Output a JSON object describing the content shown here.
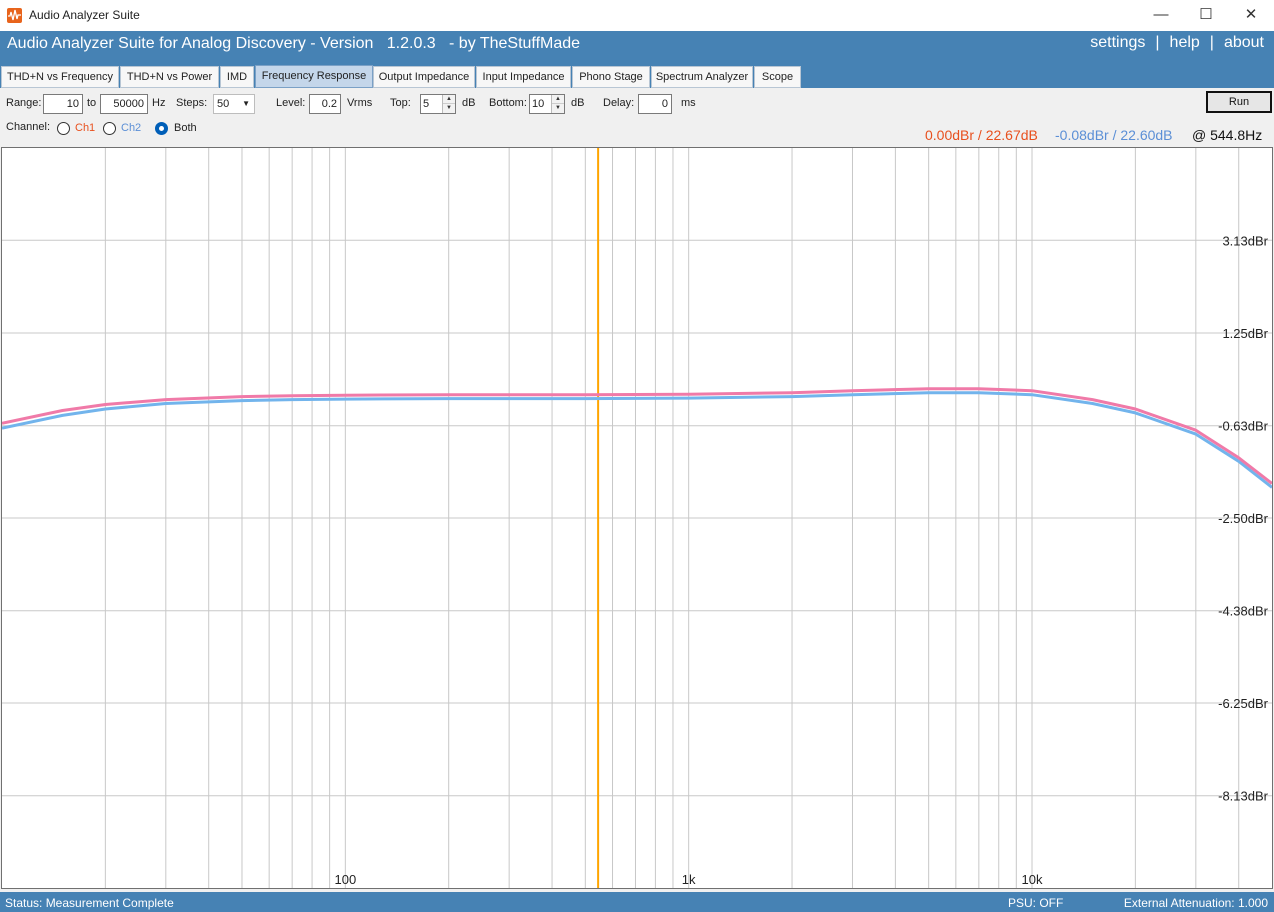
{
  "window": {
    "title": "Audio Analyzer Suite",
    "controls": {
      "minimize": "—",
      "maximize": "☐",
      "close": "✕"
    }
  },
  "header": {
    "app_title": "Audio Analyzer Suite for Analog Discovery - Version   1.2.0.3   - by TheStuffMade",
    "links": [
      "settings",
      "help",
      "about"
    ],
    "separator": "|"
  },
  "tabs": [
    {
      "label": "THD+N vs Frequency",
      "active": false
    },
    {
      "label": "THD+N vs Power",
      "active": false
    },
    {
      "label": "IMD",
      "active": false
    },
    {
      "label": "Frequency Response",
      "active": true
    },
    {
      "label": "Output Impedance",
      "active": false
    },
    {
      "label": "Input Impedance",
      "active": false
    },
    {
      "label": "Phono Stage",
      "active": false
    },
    {
      "label": "Spectrum Analyzer",
      "active": false
    },
    {
      "label": "Scope",
      "active": false
    }
  ],
  "controls": {
    "range_label": "Range:",
    "range_from": "10",
    "to_label": "to",
    "range_to": "50000",
    "hz_unit": "Hz",
    "steps_label": "Steps:",
    "steps_value": "50",
    "level_label": "Level:",
    "level_value": "0.2",
    "level_unit": "Vrms",
    "top_label": "Top:",
    "top_value": "5",
    "top_unit": "dB",
    "bottom_label": "Bottom:",
    "bottom_value": "10",
    "bottom_unit": "dB",
    "delay_label": "Delay:",
    "delay_value": "0",
    "delay_unit": "ms",
    "run_label": "Run",
    "channel_label": "Channel:",
    "channels": [
      {
        "label": "Ch1",
        "checked": false,
        "color": "#e8501e"
      },
      {
        "label": "Ch2",
        "checked": false,
        "color": "#5b8fd6"
      },
      {
        "label": "Both",
        "checked": true,
        "color": "#222222"
      }
    ]
  },
  "readout": {
    "ch1": "0.00dBr / 22.67dB",
    "ch2": "-0.08dBr / 22.60dB",
    "freq": "@ 544.8Hz",
    "ch1_color": "#e8501e",
    "ch2_color": "#5b8fd6"
  },
  "chart_data": {
    "type": "line",
    "x_scale": "log",
    "xlim": [
      10,
      50000
    ],
    "ylim": [
      -10,
      5
    ],
    "x_tick_labels": [
      {
        "value": 100,
        "label": "100"
      },
      {
        "value": 1000,
        "label": "1k"
      },
      {
        "value": 10000,
        "label": "10k"
      }
    ],
    "y_tick_labels": [
      {
        "value": 3.13,
        "label": "3.13dBr"
      },
      {
        "value": 1.25,
        "label": "1.25dBr"
      },
      {
        "value": -0.63,
        "label": "-0.63dBr"
      },
      {
        "value": -2.5,
        "label": "-2.50dBr"
      },
      {
        "value": -4.38,
        "label": "-4.38dBr"
      },
      {
        "value": -6.25,
        "label": "-6.25dBr"
      },
      {
        "value": -8.13,
        "label": "-8.13dBr"
      }
    ],
    "cursor_x": 544.8,
    "cursor_color": "#ffa500",
    "grid": true,
    "series": [
      {
        "color": "#f07aa8",
        "x": [
          10,
          15,
          20,
          30,
          50,
          70,
          100,
          200,
          500,
          1000,
          2000,
          3000,
          5000,
          7000,
          10000,
          15000,
          20000,
          30000,
          40000,
          50000
        ],
        "y": [
          -0.58,
          -0.32,
          -0.2,
          -0.1,
          -0.04,
          -0.02,
          -0.01,
          0.0,
          0.0,
          0.01,
          0.04,
          0.08,
          0.12,
          0.12,
          0.08,
          -0.1,
          -0.29,
          -0.72,
          -1.28,
          -1.8
        ]
      },
      {
        "color": "#72b4ec",
        "x": [
          10,
          15,
          20,
          30,
          50,
          70,
          100,
          200,
          500,
          1000,
          2000,
          3000,
          5000,
          7000,
          10000,
          15000,
          20000,
          30000,
          40000,
          50000
        ],
        "y": [
          -0.68,
          -0.42,
          -0.29,
          -0.18,
          -0.12,
          -0.1,
          -0.09,
          -0.08,
          -0.08,
          -0.07,
          -0.04,
          0.0,
          0.04,
          0.04,
          0.0,
          -0.18,
          -0.37,
          -0.8,
          -1.35,
          -1.88
        ]
      }
    ]
  },
  "status": {
    "text": "Status: Measurement Complete",
    "psu": "PSU: OFF",
    "attenuation": "External Attenuation: 1.000"
  }
}
